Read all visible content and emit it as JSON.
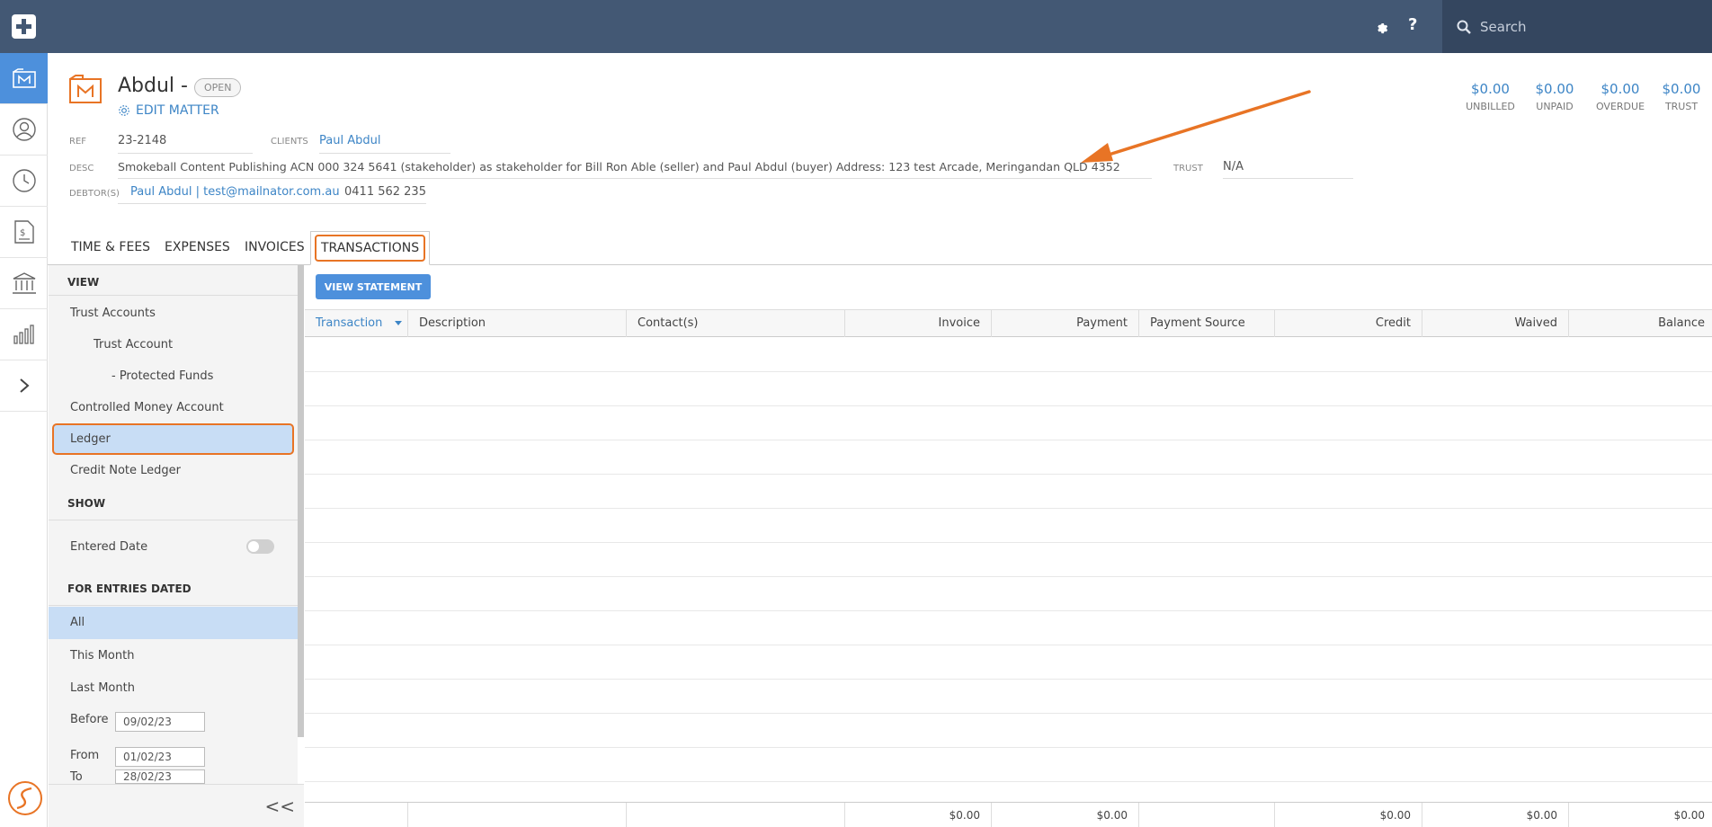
{
  "topbar": {
    "help_label": "?",
    "search_placeholder": "Search"
  },
  "matter": {
    "title": "Abdul -",
    "status": "OPEN",
    "edit_label": "EDIT MATTER",
    "ref_label": "REF",
    "ref_value": "23-2148",
    "clients_label": "CLIENTS",
    "clients_value": "Paul Abdul",
    "desc_label": "DESC",
    "desc_value": "Smokeball Content Publishing ACN 000 324 5641 (stakeholder) as stakeholder for Bill Ron Able (seller) and Paul Abdul (buyer) Address: 123 test Arcade, Meringandan QLD 4352",
    "trust_label": "TRUST",
    "trust_value": "N/A",
    "debtors_label": "DEBTOR(S)",
    "debtor_name": "Paul Abdul | test@mailnator.com.au",
    "debtor_phone": "0411 562 235"
  },
  "summary": [
    {
      "amount": "$0.00",
      "label": "UNBILLED"
    },
    {
      "amount": "$0.00",
      "label": "UNPAID"
    },
    {
      "amount": "$0.00",
      "label": "OVERDUE"
    },
    {
      "amount": "$0.00",
      "label": "TRUST"
    }
  ],
  "tabs": [
    "TIME & FEES",
    "EXPENSES",
    "INVOICES",
    "TRANSACTIONS"
  ],
  "panel": {
    "view_heading": "VIEW",
    "view_items": [
      "Trust Accounts",
      "Trust Account",
      "- Protected Funds",
      "Controlled Money Account",
      "Ledger",
      "Credit Note Ledger"
    ],
    "show_heading": "SHOW",
    "entered_date_label": "Entered Date",
    "entries_heading": "FOR ENTRIES DATED",
    "date_items": [
      "All",
      "This Month",
      "Last Month"
    ],
    "before_label": "Before",
    "before_value": "09/02/23",
    "from_label": "From",
    "from_value": "01/02/23",
    "to_label": "To",
    "to_value": "28/02/23",
    "collapse_label": "<<"
  },
  "grid": {
    "button_label": "VIEW STATEMENT",
    "columns": [
      "Transaction",
      "Description",
      "Contact(s)",
      "Invoice",
      "Payment",
      "Payment Source",
      "Credit",
      "Waived",
      "Balance"
    ],
    "totals": [
      "",
      "",
      "",
      "$0.00",
      "$0.00",
      "",
      "$0.00",
      "$0.00",
      "$0.00"
    ]
  },
  "colors": {
    "topbar": "#435874",
    "accent": "#4d90dc",
    "highlight": "#e87425",
    "link": "#3d85c6"
  }
}
